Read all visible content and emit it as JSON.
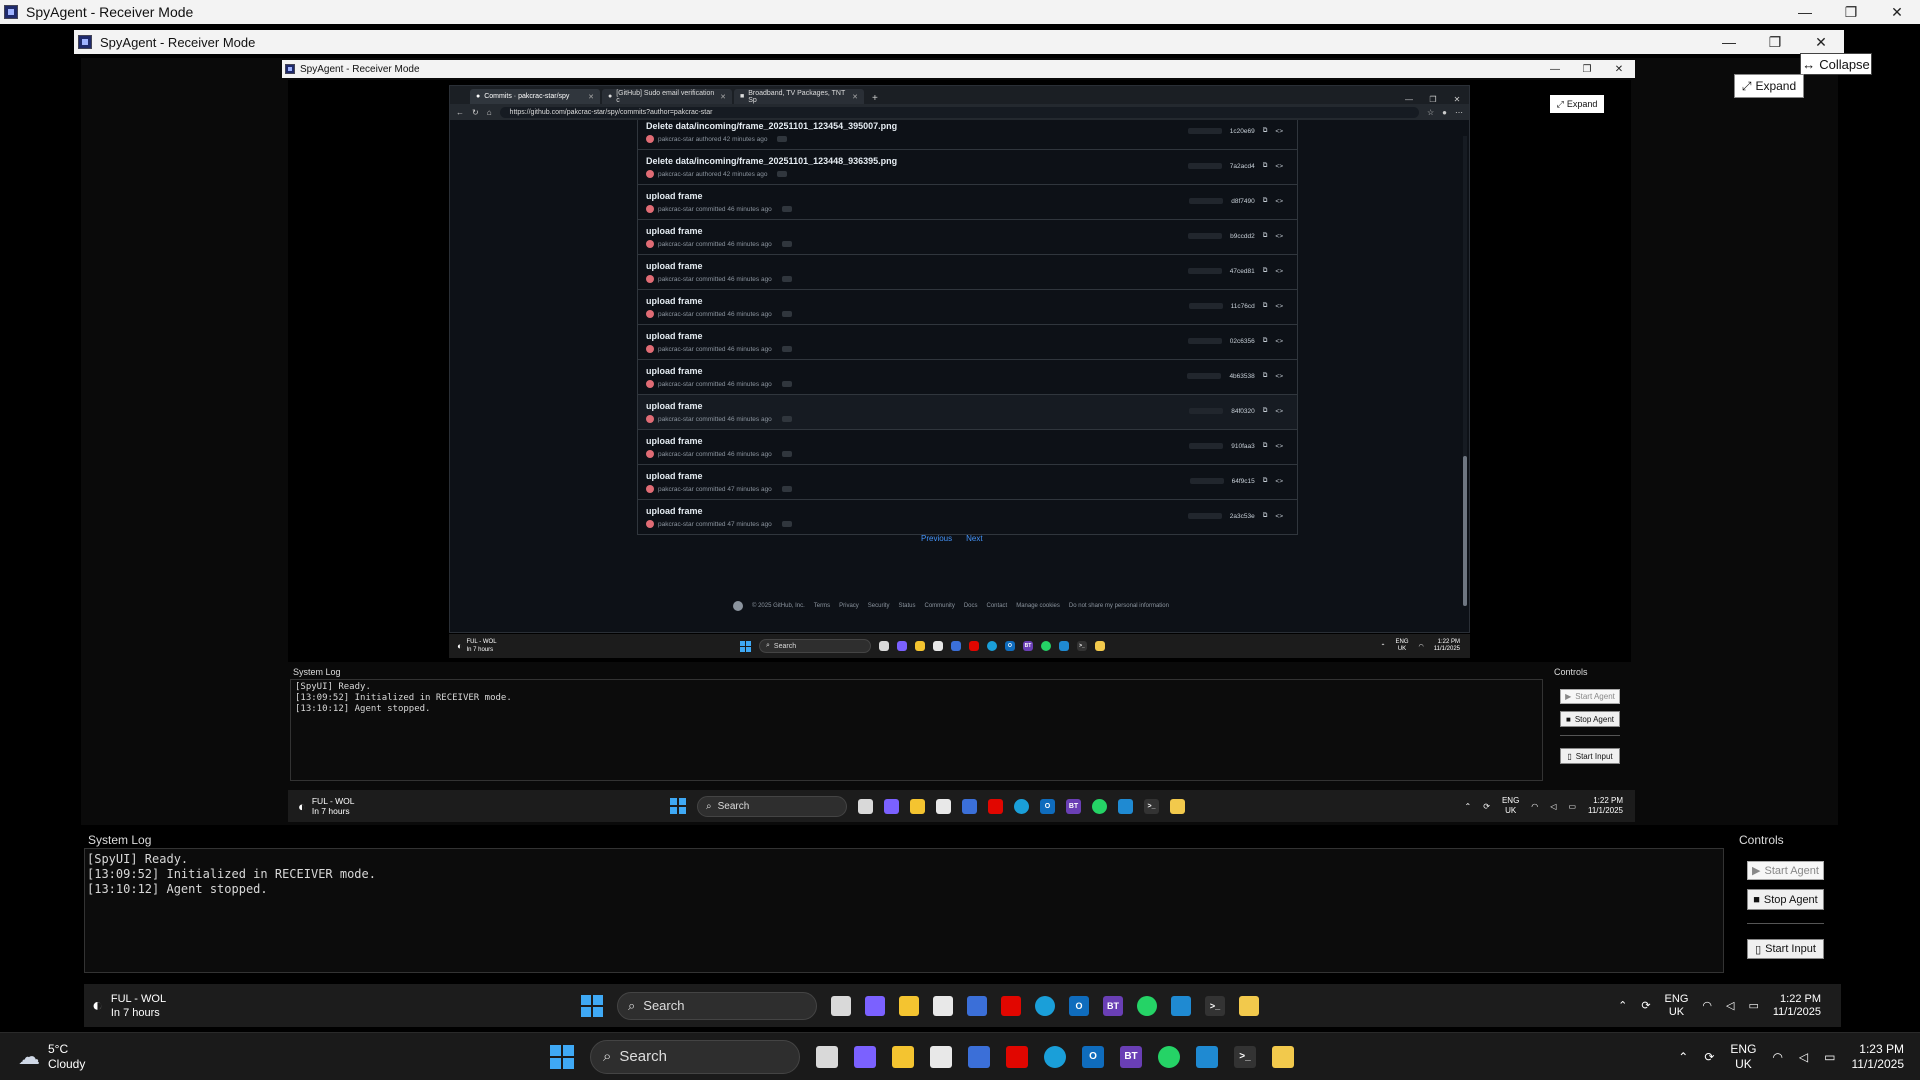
{
  "window": {
    "title": "SpyAgent - Receiver Mode",
    "controls": [
      "—",
      "❐",
      "✕"
    ]
  },
  "inner_window": {
    "title": "SpyAgent - Receiver Mode"
  },
  "innermost_window": {
    "title": "SpyAgent - Receiver Mode"
  },
  "buttons": {
    "collapse": "Collapse",
    "expand": "Expand"
  },
  "browser": {
    "tabs": [
      {
        "label": "Commits · pakcrac-star/spy",
        "active": true
      },
      {
        "label": "[GitHub] Sudo email verification c",
        "active": false
      },
      {
        "label": "Broadband, TV Packages, TNT Sp",
        "active": false
      }
    ],
    "url": "https://github.com/pakcrac-star/spy/commits?author=pakcrac-star",
    "commits": [
      {
        "title": "Delete data/incoming/frame_20251101_123454_395007.png",
        "meta": "pakcrac-star authored 42 minutes ago",
        "sha": "1c20e69"
      },
      {
        "title": "Delete data/incoming/frame_20251101_123448_936395.png",
        "meta": "pakcrac-star authored 42 minutes ago",
        "sha": "7a2acd4"
      },
      {
        "title": "upload frame",
        "meta": "pakcrac-star committed 46 minutes ago",
        "sha": "d8f7490"
      },
      {
        "title": "upload frame",
        "meta": "pakcrac-star committed 46 minutes ago",
        "sha": "b9ccdd2"
      },
      {
        "title": "upload frame",
        "meta": "pakcrac-star committed 46 minutes ago",
        "sha": "47ced81"
      },
      {
        "title": "upload frame",
        "meta": "pakcrac-star committed 46 minutes ago",
        "sha": "11c76cd"
      },
      {
        "title": "upload frame",
        "meta": "pakcrac-star committed 46 minutes ago",
        "sha": "02c6356"
      },
      {
        "title": "upload frame",
        "meta": "pakcrac-star committed 46 minutes ago",
        "sha": "4b63538"
      },
      {
        "title": "upload frame",
        "meta": "pakcrac-star committed 46 minutes ago",
        "sha": "84f0320"
      },
      {
        "title": "upload frame",
        "meta": "pakcrac-star committed 46 minutes ago",
        "sha": "910faa3"
      },
      {
        "title": "upload frame",
        "meta": "pakcrac-star committed 47 minutes ago",
        "sha": "64f9c15"
      },
      {
        "title": "upload frame",
        "meta": "pakcrac-star committed 47 minutes ago",
        "sha": "2a3c53e"
      }
    ],
    "pager": {
      "previous": "Previous",
      "next": "Next"
    },
    "footer": [
      "© 2025 GitHub, Inc.",
      "Terms",
      "Privacy",
      "Security",
      "Status",
      "Community",
      "Docs",
      "Contact",
      "Manage cookies",
      "Do not share my personal information"
    ]
  },
  "log": {
    "label": "System Log",
    "lines": "[SpyUI] Ready.\n[13:09:52] Initialized in RECEIVER mode.\n[13:10:12] Agent stopped."
  },
  "controls": {
    "label": "Controls",
    "start_agent": "Start Agent",
    "stop_agent": "Stop Agent",
    "start_input": "Start Input"
  },
  "taskbar_inner": {
    "weather_title": "FUL - WOL",
    "weather_sub": "In 7 hours",
    "search": "Search",
    "lang": "ENG",
    "region": "UK",
    "time_small": "1:22 PM",
    "date": "11/1/2025"
  },
  "taskbar_main": {
    "temp": "5°C",
    "condition": "Cloudy",
    "search": "Search",
    "lang": "ENG",
    "region": "UK",
    "time": "1:23 PM",
    "date": "11/1/2025"
  },
  "colors": {
    "accent": "#3fa9f5",
    "github_link": "#4493f8",
    "background": "#000000"
  },
  "icons": [
    "file-explorer-icon",
    "copilot-icon",
    "folder-icon",
    "store-icon",
    "app-icon",
    "santander-icon",
    "edge-icon",
    "outlook-icon",
    "bt-icon",
    "whatsapp-icon",
    "vscode-icon",
    "terminal-icon",
    "python-icon"
  ]
}
